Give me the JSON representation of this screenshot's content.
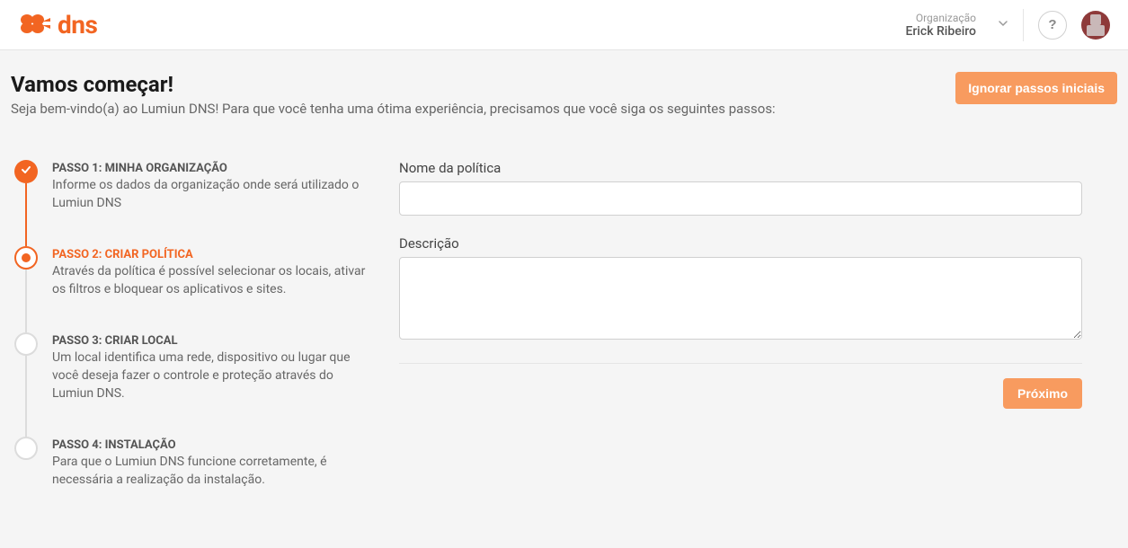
{
  "brand": {
    "name": "dns",
    "accent": "#f26522"
  },
  "header": {
    "org_label": "Organização",
    "org_name": "Erick Ribeiro",
    "help_label": "?"
  },
  "page": {
    "title": "Vamos começar!",
    "subtitle": "Seja bem-vindo(a) ao Lumiun DNS! Para que você tenha uma ótima experiência, precisamos que você siga os seguintes passos:",
    "skip_label": "Ignorar passos iniciais"
  },
  "steps": [
    {
      "state": "completed",
      "title": "PASSO 1: MINHA ORGANIZAÇÃO",
      "desc": "Informe os dados da organização onde será utilizado o Lumiun DNS"
    },
    {
      "state": "active",
      "title": "PASSO 2: CRIAR POLÍTICA",
      "desc": "Através da política é possível selecionar os locais, ativar os filtros e bloquear os aplicativos e sites."
    },
    {
      "state": "pending",
      "title": "PASSO 3: CRIAR LOCAL",
      "desc": "Um local identifica uma rede, dispositivo ou lugar que você deseja fazer o controle e proteção através do Lumiun DNS."
    },
    {
      "state": "pending",
      "title": "PASSO 4: INSTALAÇÃO",
      "desc": "Para que o Lumiun DNS funcione corretamente, é necessária a realização da instalação."
    }
  ],
  "form": {
    "name_label": "Nome da política",
    "name_value": "",
    "desc_label": "Descrição",
    "desc_value": "",
    "next_label": "Próximo"
  }
}
